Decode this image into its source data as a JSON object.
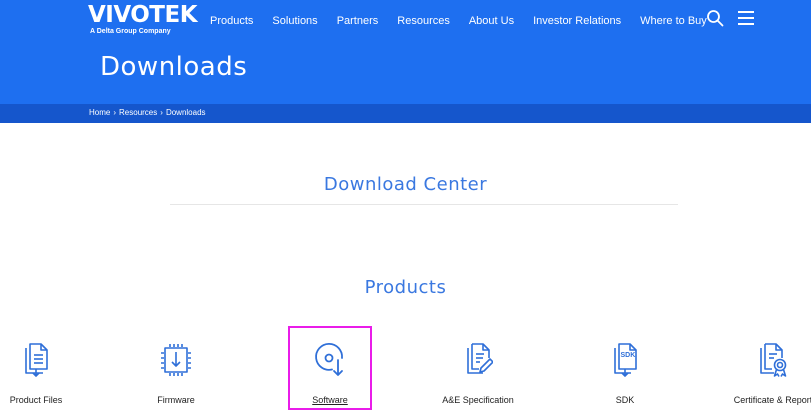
{
  "header": {
    "logo_main": "VIVOTEK",
    "logo_sub": "A Delta Group Company",
    "nav": [
      "Products",
      "Solutions",
      "Partners",
      "Resources",
      "About Us",
      "Investor Relations",
      "Where to Buy"
    ],
    "page_title": "Downloads"
  },
  "breadcrumb": [
    "Home",
    "Resources",
    "Downloads"
  ],
  "breadcrumb_sep": "›",
  "main": {
    "section_title": "Download Center",
    "products_title": "Products",
    "categories": [
      {
        "label": "Product Files",
        "icon": "product-files-icon"
      },
      {
        "label": "Firmware",
        "icon": "firmware-icon"
      },
      {
        "label": "Software",
        "icon": "software-icon",
        "selected": true
      },
      {
        "label": "A&E Specification",
        "icon": "ae-spec-icon"
      },
      {
        "label": "SDK",
        "icon": "sdk-icon"
      },
      {
        "label": "Certificate & Report",
        "icon": "certificate-icon"
      }
    ]
  },
  "colors": {
    "brand_blue": "#1e6ff0",
    "breadcrumb_blue": "#1556cc",
    "heading_blue": "#3a78e0",
    "icon_blue": "#2f6fd8",
    "highlight": "#e91ce9"
  }
}
